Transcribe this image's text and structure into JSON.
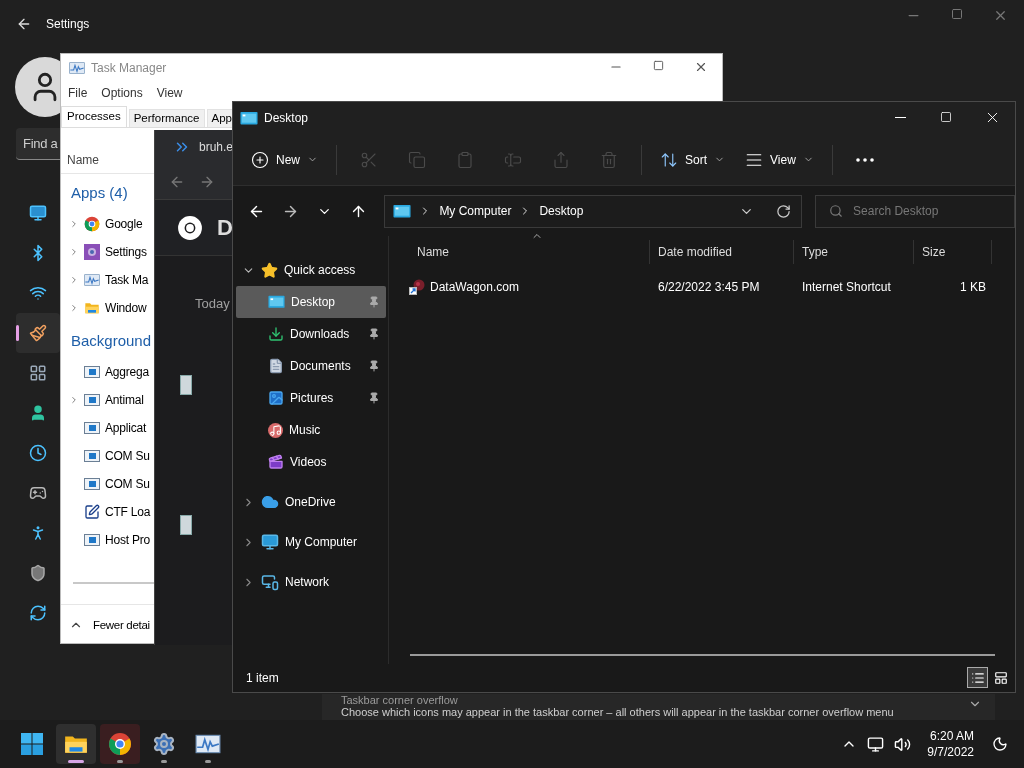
{
  "settings": {
    "title": "Settings",
    "search_placeholder": "Find a",
    "nav": [
      {
        "kind": "system",
        "selected": false
      },
      {
        "kind": "bluetooth",
        "selected": false
      },
      {
        "kind": "network",
        "selected": false
      },
      {
        "kind": "personalization",
        "selected": true
      },
      {
        "kind": "apps",
        "selected": false
      },
      {
        "kind": "accounts",
        "selected": false
      },
      {
        "kind": "time",
        "selected": false
      },
      {
        "kind": "gaming",
        "selected": false
      },
      {
        "kind": "accessibility",
        "selected": false
      },
      {
        "kind": "privacy",
        "selected": false
      },
      {
        "kind": "update",
        "selected": false
      }
    ],
    "card": {
      "title": "Taskbar corner overflow",
      "description": "Choose which icons may appear in the taskbar corner – all others will appear in the taskbar corner overflow menu"
    }
  },
  "task_manager": {
    "title": "Task Manager",
    "menu": [
      "File",
      "Options",
      "View"
    ],
    "tabs": [
      {
        "label": "Processes",
        "selected": true
      },
      {
        "label": "Performance",
        "selected": false
      },
      {
        "label": "App",
        "selected": false
      }
    ],
    "column": "Name",
    "groups": [
      {
        "title": "Apps (4)",
        "rows": [
          {
            "name": "Google",
            "kind": "chrome",
            "expandable": true
          },
          {
            "name": "Settings",
            "kind": "settings",
            "expandable": true
          },
          {
            "name": "Task Ma",
            "kind": "taskmgr",
            "expandable": true
          },
          {
            "name": "Window",
            "kind": "explorer",
            "expandable": true
          }
        ]
      },
      {
        "title": "Background",
        "rows": [
          {
            "name": "Aggrega",
            "kind": "service",
            "expandable": false
          },
          {
            "name": "Antimal",
            "kind": "service",
            "expandable": true
          },
          {
            "name": "Applicat",
            "kind": "service",
            "expandable": false
          },
          {
            "name": "COM Su",
            "kind": "service",
            "expandable": false
          },
          {
            "name": "COM Su",
            "kind": "service",
            "expandable": false
          },
          {
            "name": "CTF Loa",
            "kind": "editor",
            "expandable": false
          },
          {
            "name": "Host Pro",
            "kind": "service",
            "expandable": false
          }
        ]
      }
    ],
    "footer": "Fewer detai"
  },
  "browser": {
    "tab_title": "bruh.e",
    "heading": "D",
    "section": "Today"
  },
  "explorer": {
    "title": "Desktop",
    "toolbar": [
      {
        "kind": "new",
        "label": "New",
        "disabled": false
      },
      {
        "kind": "cut",
        "disabled": true
      },
      {
        "kind": "copy",
        "disabled": true
      },
      {
        "kind": "paste",
        "disabled": true
      },
      {
        "kind": "rename",
        "disabled": true
      },
      {
        "kind": "share",
        "disabled": true
      },
      {
        "kind": "delete",
        "disabled": true
      },
      {
        "kind": "sort",
        "label": "Sort",
        "disabled": false
      },
      {
        "kind": "view",
        "label": "View",
        "disabled": false
      },
      {
        "kind": "more",
        "disabled": false
      }
    ],
    "path": [
      "My Computer",
      "Desktop"
    ],
    "search_placeholder": "Search Desktop",
    "tree": [
      {
        "label": "Quick access",
        "kind": "star",
        "expanded": true,
        "selected": false,
        "children": [
          {
            "label": "Desktop",
            "kind": "desktop",
            "selected": true,
            "pinned": true
          },
          {
            "label": "Downloads",
            "kind": "downloads",
            "selected": false,
            "pinned": true
          },
          {
            "label": "Documents",
            "kind": "documents",
            "selected": false,
            "pinned": true
          },
          {
            "label": "Pictures",
            "kind": "pictures",
            "selected": false,
            "pinned": true
          },
          {
            "label": "Music",
            "kind": "music",
            "selected": false,
            "pinned": false
          },
          {
            "label": "Videos",
            "kind": "videos",
            "selected": false,
            "pinned": false
          }
        ]
      },
      {
        "label": "OneDrive",
        "kind": "cloud",
        "expanded": false,
        "selected": false
      },
      {
        "label": "My Computer",
        "kind": "computer",
        "expanded": false,
        "selected": false
      },
      {
        "label": "Network",
        "kind": "network",
        "expanded": false,
        "selected": false
      }
    ],
    "columns": [
      "Name",
      "Date modified",
      "Type",
      "Size"
    ],
    "rows": [
      {
        "name": "DataWagon.com",
        "date": "6/22/2022 3:45 PM",
        "type": "Internet Shortcut",
        "size": "1 KB"
      }
    ],
    "status": "1 item",
    "views": [
      {
        "kind": "details",
        "selected": true
      },
      {
        "kind": "tiles",
        "selected": false
      }
    ]
  },
  "taskbar": {
    "apps": [
      {
        "kind": "start",
        "active": false,
        "running": false,
        "flashing": false
      },
      {
        "kind": "explorer",
        "active": true,
        "running": true,
        "flashing": false
      },
      {
        "kind": "chrome",
        "active": false,
        "running": true,
        "flashing": true
      },
      {
        "kind": "settings",
        "active": false,
        "running": true,
        "flashing": false
      },
      {
        "kind": "taskmgr",
        "active": false,
        "running": true,
        "flashing": false
      }
    ],
    "time": "6:20 AM",
    "date": "9/7/2022"
  }
}
